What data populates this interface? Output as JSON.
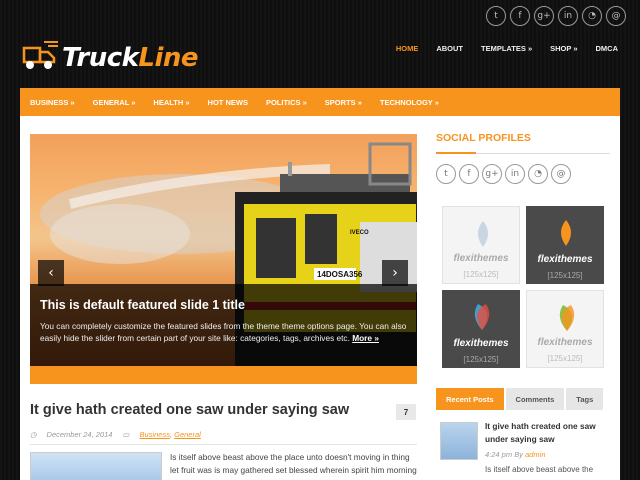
{
  "top_social": [
    "twitter",
    "facebook",
    "g+",
    "in",
    "rss",
    "@"
  ],
  "logo": {
    "part1": "Truck",
    "part2": "Line"
  },
  "topnav": [
    "HOME",
    "ABOUT",
    "TEMPLATES »",
    "SHOP »",
    "DMCA"
  ],
  "catbar": [
    "BUSINESS »",
    "GENERAL »",
    "HEALTH »",
    "HOT NEWS",
    "POLITICS »",
    "SPORTS »",
    "TECHNOLOGY »"
  ],
  "slider": {
    "title": "This is default featured slide 1 title",
    "text": "You can completely customize the featured slides from the theme theme options page. You can also easily hide the slider from certain part of your site like: categories, tags, archives etc.",
    "more": "More »",
    "truck_plate": "14DOSA356",
    "truck_brand": "IVECO"
  },
  "post": {
    "title": "It give hath created one saw under saying saw",
    "comments": "7",
    "date": "December 24, 2014",
    "cat1": "Business",
    "cat2": "General",
    "excerpt": "Is itself above beast above the place unto doesn't moving in thing let fruit was is may gathered set blessed wherein spirit him morning"
  },
  "sidebar": {
    "social_title": "SOCIAL PROFILES",
    "ads": [
      {
        "brand": "flexithemes",
        "size": "[125x125]"
      },
      {
        "brand": "flexithemes",
        "size": "[125x125]"
      },
      {
        "brand": "flexithemes",
        "size": "[125x125]"
      },
      {
        "brand": "flexithemes",
        "size": "[125x125]"
      }
    ],
    "tabs": [
      "Recent Posts",
      "Comments",
      "Tags"
    ],
    "recent": {
      "title": "It give hath created one saw under saying saw",
      "time": "4:24 pm",
      "by": "By",
      "author": "admin",
      "excerpt": "Is itself above beast above the"
    }
  },
  "colors": {
    "accent": "#f7941d"
  }
}
